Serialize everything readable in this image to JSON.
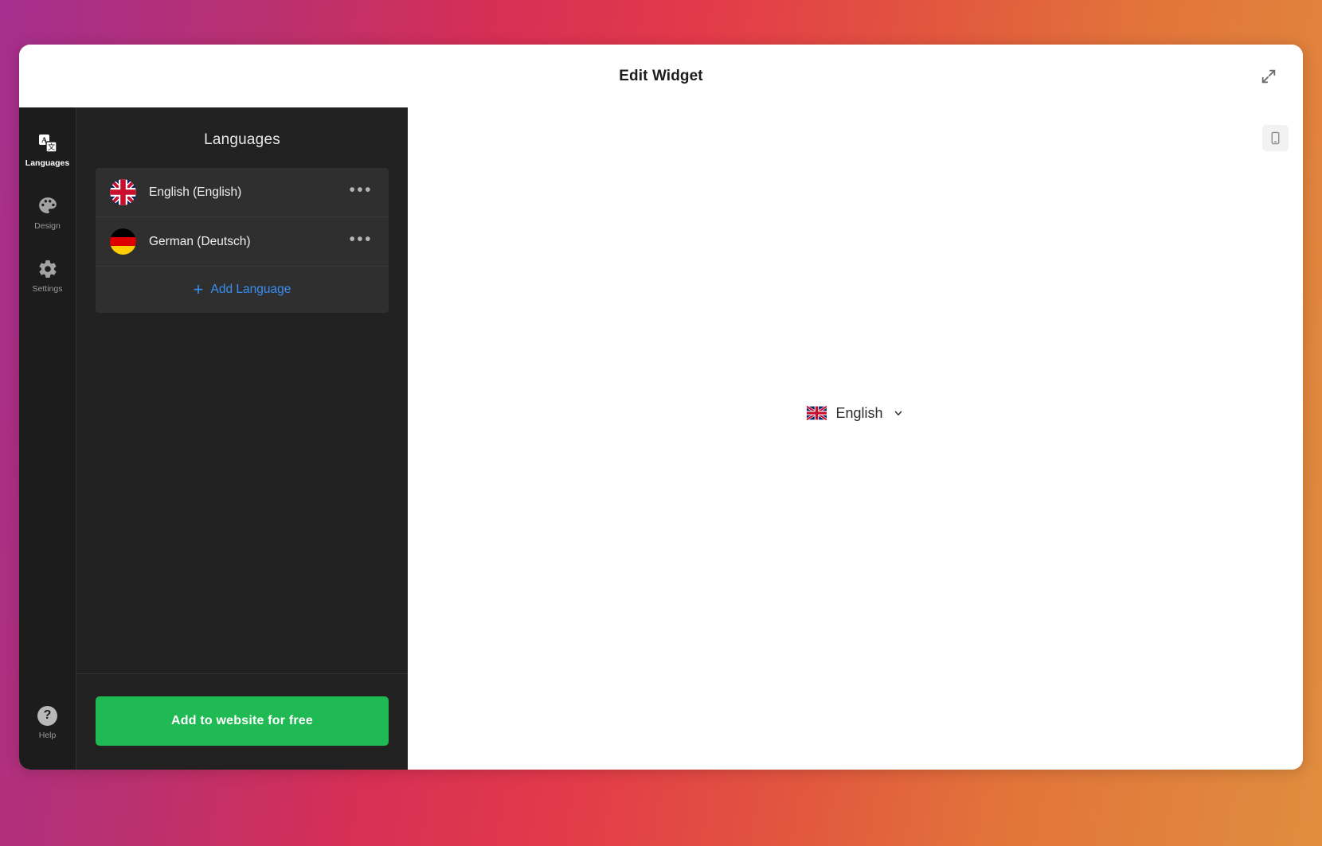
{
  "window": {
    "title": "Edit Widget",
    "expand_icon": "expand-diagonal-icon"
  },
  "rail": {
    "items": [
      {
        "label": "Languages",
        "icon": "translate-icon",
        "active": true
      },
      {
        "label": "Design",
        "icon": "palette-icon",
        "active": false
      },
      {
        "label": "Settings",
        "icon": "gear-icon",
        "active": false
      }
    ],
    "help": {
      "label": "Help",
      "icon": "question-mark-icon"
    }
  },
  "panel": {
    "title": "Languages",
    "languages": [
      {
        "name": "English (English)",
        "flag": "flag-gb-icon",
        "menu_icon": "ellipsis-icon"
      },
      {
        "name": "German (Deutsch)",
        "flag": "flag-de-icon",
        "menu_icon": "ellipsis-icon"
      }
    ],
    "add_language": {
      "label": "Add Language",
      "icon": "plus-icon"
    },
    "cta": {
      "label": "Add to website for free",
      "color": "#1fba53"
    }
  },
  "preview": {
    "device_toggle": {
      "icon": "mobile-phone-icon"
    },
    "widget": {
      "label": "English",
      "flag": "flag-gb-icon",
      "chevron": "chevron-down-icon"
    }
  },
  "colors": {
    "accent_link": "#3b8ef0",
    "cta_green": "#1fba53",
    "panel_bg": "#212121",
    "rail_bg": "#1c1c1c",
    "card_bg": "#2f2f2f"
  }
}
